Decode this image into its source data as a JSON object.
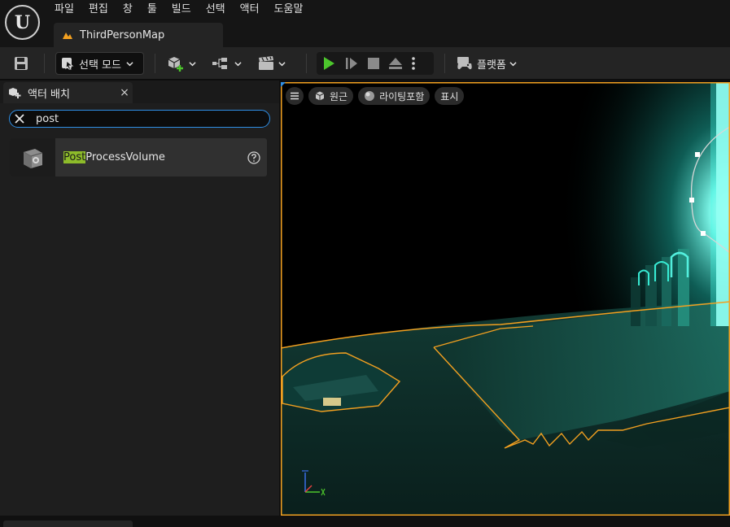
{
  "menu": [
    "파일",
    "편집",
    "창",
    "툴",
    "빌드",
    "선택",
    "액터",
    "도움말"
  ],
  "map_tab": {
    "label": "ThirdPersonMap"
  },
  "toolbar": {
    "mode_label": "선택 모드",
    "platform_label": "플랫폼"
  },
  "panel": {
    "tab_label": "액터 배치",
    "close_glyph": "×",
    "search_value": "post",
    "result": {
      "highlight": "Post",
      "rest": "ProcessVolume"
    }
  },
  "viewport": {
    "perspective_label": "원근",
    "lighting_label": "라이팅포함",
    "show_label": "표시"
  },
  "colors": {
    "accent_blue": "#2f8fe6",
    "play_green": "#4cc52c",
    "search_highlight": "#8dbb2a",
    "selection_orange": "#f2a020",
    "glow_cyan": "#40ffea"
  },
  "icons": {
    "app_logo": "unreal-logo-icon",
    "save": "save-icon",
    "select_mode": "select-mode-icon",
    "add_actor": "add-actor-icon",
    "blueprint": "blueprint-icon",
    "cinematics": "clapperboard-icon",
    "play": "play-icon",
    "advance_frame": "advance-frame-icon",
    "stop": "stop-icon",
    "eject": "eject-icon",
    "more": "more-options-icon",
    "platforms": "gamepad-icon",
    "clear_search": "clear-search-icon",
    "help": "help-icon"
  }
}
